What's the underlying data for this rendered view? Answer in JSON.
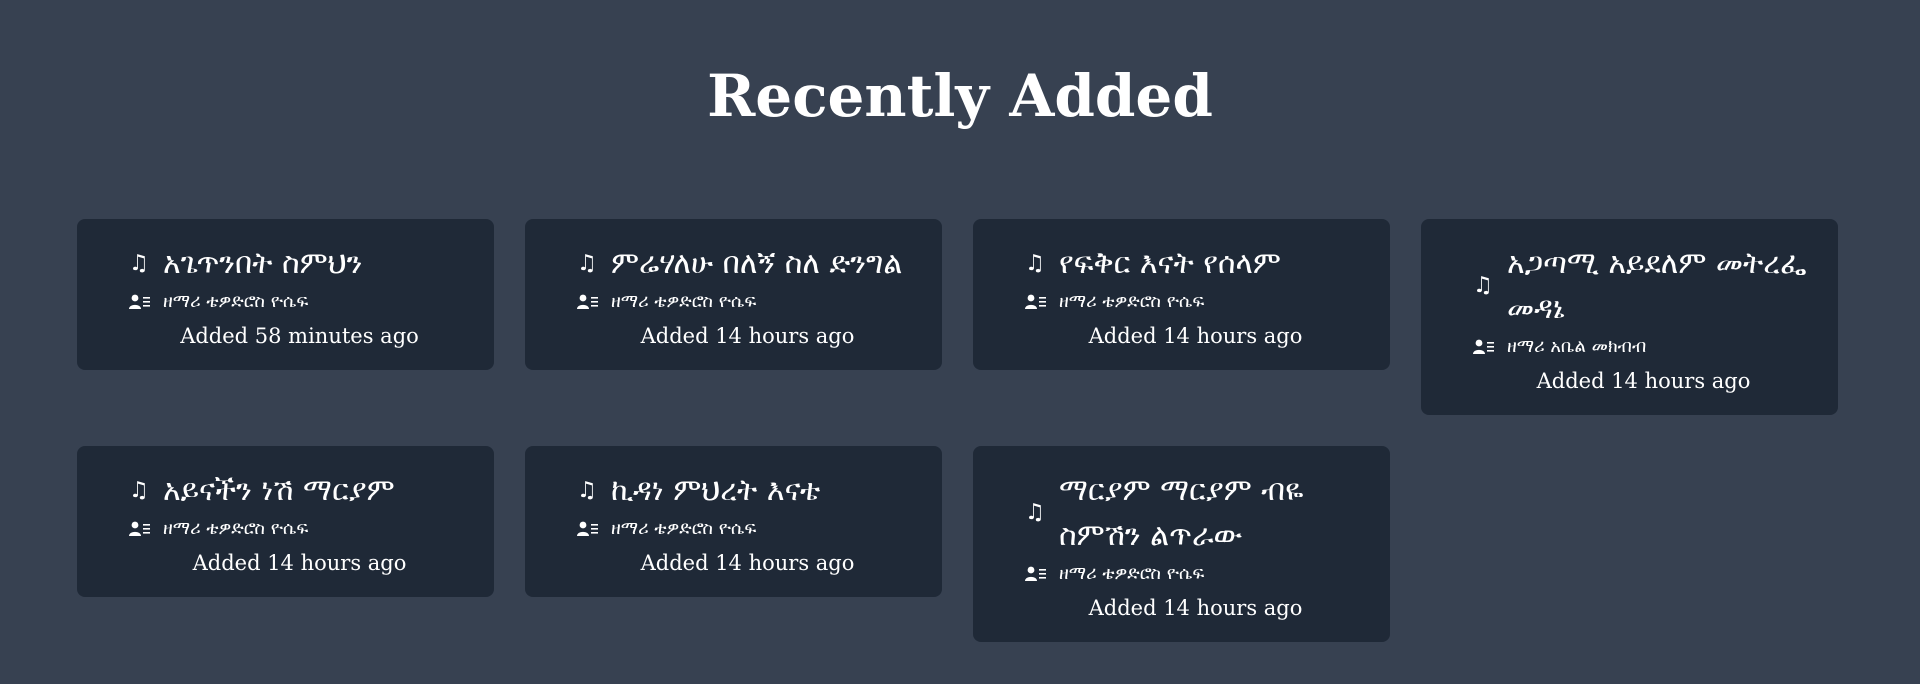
{
  "page": {
    "title": "Recently Added",
    "background_color": "#374151",
    "card_color": "#1f2937"
  },
  "songs": [
    {
      "title": "አጌጥንበት ስምህን",
      "artist": "ዘማሪ ቴዎድሮስ ዮሴፍ",
      "added": "Added 58 minutes ago",
      "icon": "music-note-icon",
      "artist_icon": "user-list-icon"
    },
    {
      "title": "ምሬሃለሁ በለኝ ስለ ድንግል",
      "artist": "ዘማሪ ቴዎድሮስ ዮሴፍ",
      "added": "Added 14 hours ago",
      "icon": "music-note-icon",
      "artist_icon": "user-list-icon"
    },
    {
      "title": "የፍቅር እናት የሰላም",
      "artist": "ዘማሪ ቴዎድሮስ ዮሴፍ",
      "added": "Added 14 hours ago",
      "icon": "music-note-icon",
      "artist_icon": "user-list-icon"
    },
    {
      "title": "አጋጣሚ አይደለም መትረፌ መዳኔ",
      "artist": "ዘማሪ አቤል መክብብ",
      "added": "Added 14 hours ago",
      "icon": "music-note-icon",
      "artist_icon": "user-list-icon"
    },
    {
      "title": "አይናችን ነሽ ማርያም",
      "artist": "ዘማሪ ቴዎድሮስ ዮሴፍ",
      "added": "Added 14 hours ago",
      "icon": "music-note-icon",
      "artist_icon": "user-list-icon"
    },
    {
      "title": "ኪዳነ ምህረት እናቴ",
      "artist": "ዘማሪ ቴዎድሮስ ዮሴፍ",
      "added": "Added 14 hours ago",
      "icon": "music-note-icon",
      "artist_icon": "user-list-icon"
    },
    {
      "title": "ማርያም ማርያም ብዬ ስምሽን ልጥራው",
      "artist": "ዘማሪ ቴዎድሮስ ዮሴፍ",
      "added": "Added 14 hours ago",
      "icon": "music-note-icon",
      "artist_icon": "user-list-icon"
    }
  ]
}
